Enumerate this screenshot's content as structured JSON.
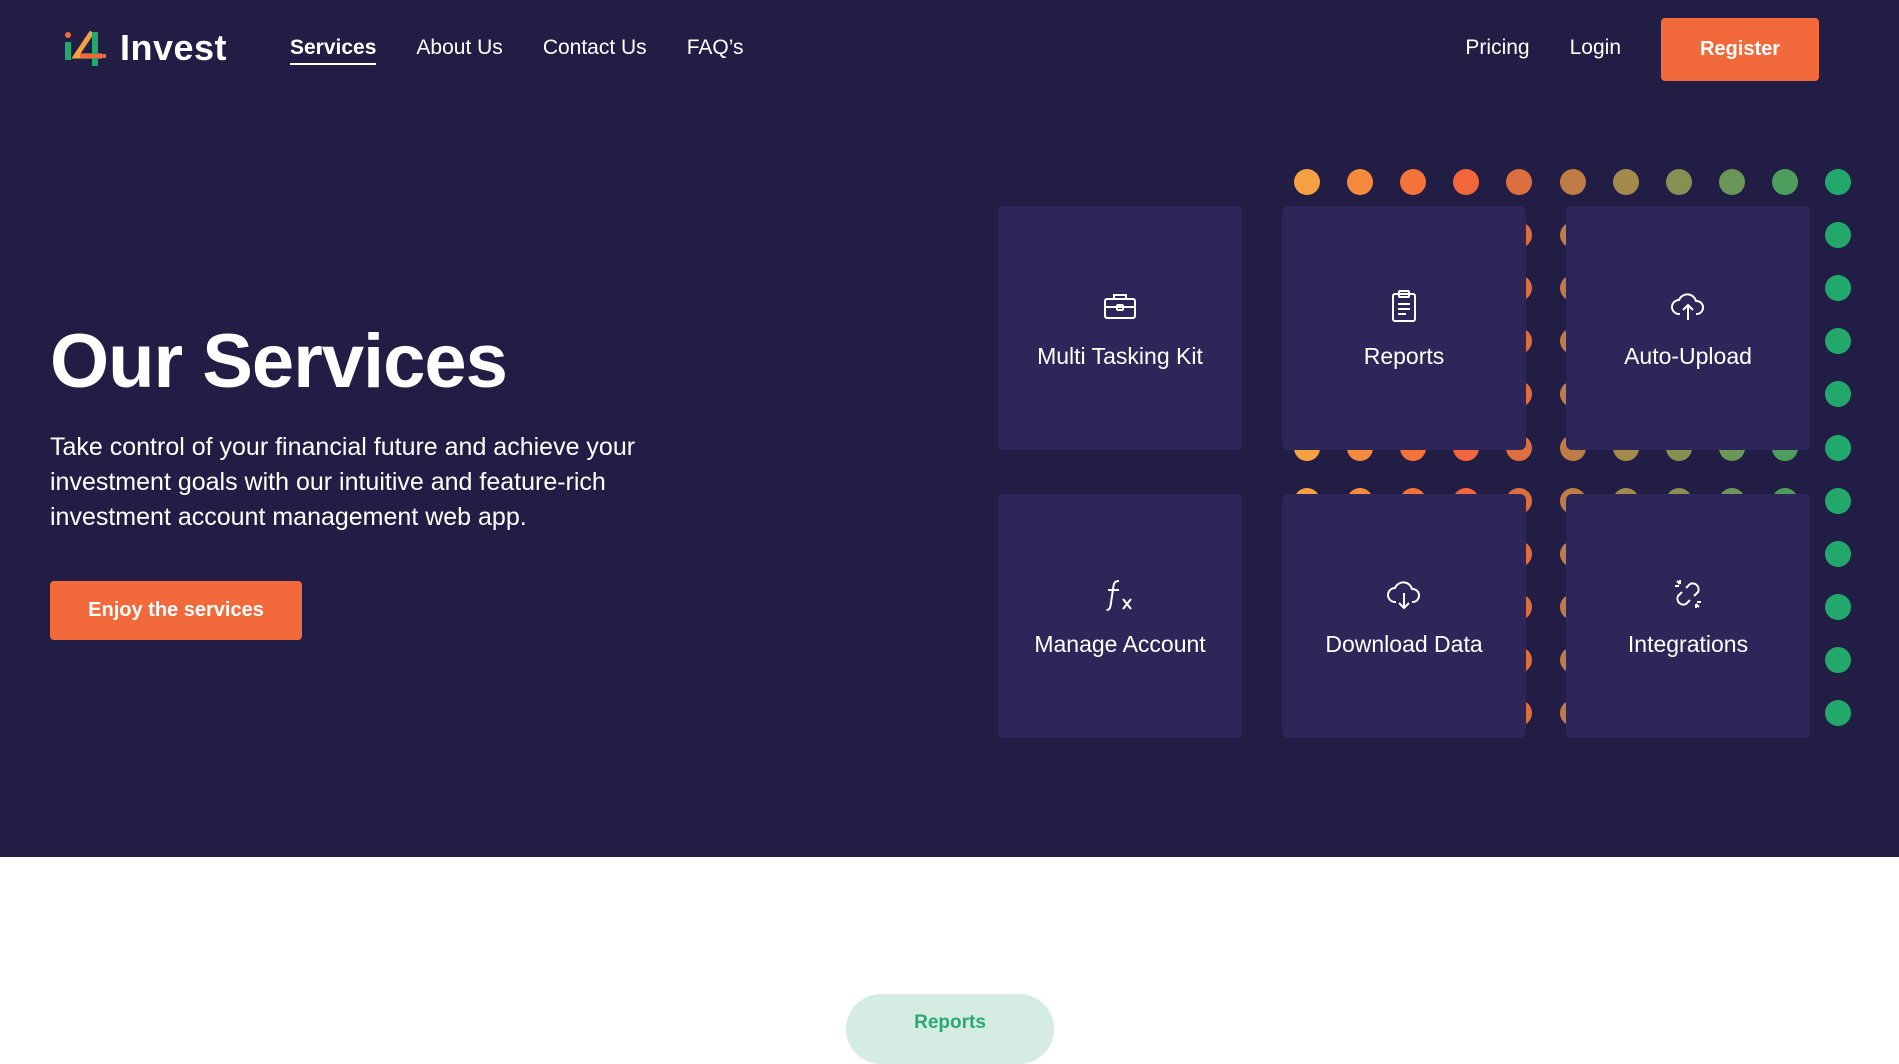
{
  "brand": {
    "logo_text": "Invest",
    "logo_mark": "i4"
  },
  "nav": {
    "links": [
      {
        "label": "Services"
      },
      {
        "label": "About Us"
      },
      {
        "label": "Contact Us"
      },
      {
        "label": "FAQ’s"
      }
    ],
    "pricing": "Pricing",
    "login": "Login",
    "register": "Register"
  },
  "hero": {
    "title": "Our Services",
    "description": "Take control of your financial future and achieve your investment goals with our intuitive and feature-rich investment account management web app.",
    "cta": "Enjoy the services"
  },
  "services": [
    {
      "label": "Multi Tasking Kit",
      "icon": "briefcase-icon"
    },
    {
      "label": "Reports",
      "icon": "clipboard-icon"
    },
    {
      "label": "Auto-Upload",
      "icon": "cloud-upload-icon"
    },
    {
      "label": "Manage Account",
      "icon": "function-icon"
    },
    {
      "label": "Download Data",
      "icon": "cloud-download-icon"
    },
    {
      "label": "Integrations",
      "icon": "link-icon"
    }
  ],
  "colors": {
    "background": "#221d44",
    "card": "#2e2559",
    "accent": "#f26a3b",
    "dot_gradient": [
      "#f5a042",
      "#f48a3c",
      "#f37338",
      "#f1663a",
      "#dc6f40",
      "#c07c45",
      "#a38a4c",
      "#888f52",
      "#6a9658",
      "#4d9e5d",
      "#22a86b"
    ]
  },
  "section2": {
    "pill": "Reports"
  }
}
